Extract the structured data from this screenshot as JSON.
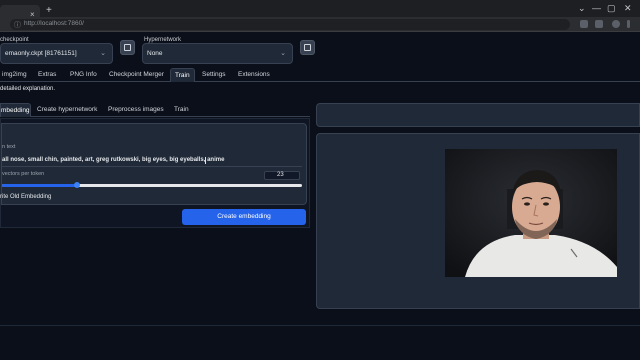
{
  "browser": {
    "close_glyph": "×",
    "newtab_glyph": "+",
    "window_controls": [
      "⌄",
      "—",
      "▢",
      "✕"
    ],
    "url": "http://localhost:7860/"
  },
  "settings": {
    "checkpoint_label": "checkpoint",
    "checkpoint_value": "emaonly.ckpt [81761151]",
    "hypernetwork_label": "Hypernetwork",
    "hypernetwork_value": "None"
  },
  "main_tabs": [
    "img2img",
    "Extras",
    "PNG Info",
    "Checkpoint Merger",
    "Train",
    "Settings",
    "Extensions"
  ],
  "info_text": "detailed explanation.",
  "sub_tabs": [
    "mbedding",
    "Create hypernetwork",
    "Preprocess images",
    "Train"
  ],
  "embedding_form": {
    "init_text_label": "n text",
    "init_text_value": "all nose, small chin, painted, art, greg rutkowski, big eyes, big eyeballs, anime",
    "vectors_label": "vectors per token",
    "vectors_value": "23",
    "vectors_fraction": 0.25,
    "overwrite_label": "rite Old Embedding",
    "create_button": "Create embedding"
  },
  "colors": {
    "background": "#0b0f19",
    "panel": "#1f2937",
    "accent": "#2563eb"
  },
  "icons": {
    "refresh": "refresh-icon",
    "chevron": "chevron-down-icon"
  }
}
